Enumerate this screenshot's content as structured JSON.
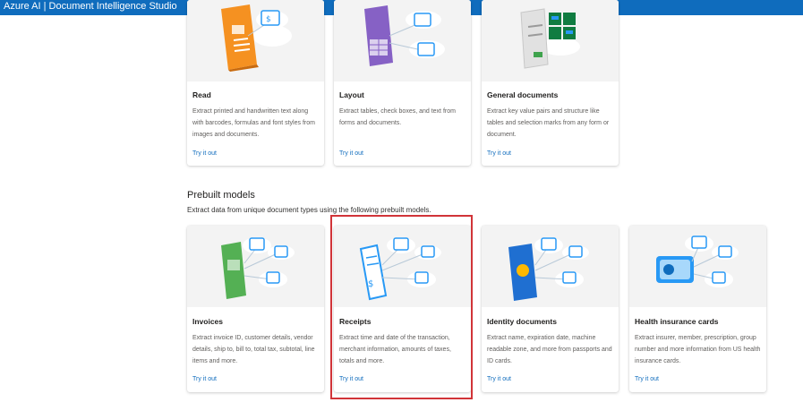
{
  "app": {
    "title": "Azure AI | Document Intelligence Studio"
  },
  "top_cards": [
    {
      "title": "Read",
      "description": "Extract printed and handwritten text along with barcodes, formulas and font styles from images and documents.",
      "link": "Try it out",
      "icon": "read-document-illustration"
    },
    {
      "title": "Layout",
      "description": "Extract tables, check boxes, and text from forms and documents.",
      "link": "Try it out",
      "icon": "layout-document-illustration"
    },
    {
      "title": "General documents",
      "description": "Extract key value pairs and structure like tables and selection marks from any form or document.",
      "link": "Try it out",
      "icon": "general-document-illustration"
    }
  ],
  "prebuilt": {
    "title": "Prebuilt models",
    "subtitle": "Extract data from unique document types using the following prebuilt models.",
    "cards": [
      {
        "title": "Invoices",
        "description": "Extract invoice ID, customer details, vendor details, ship to, bill to, total tax, subtotal, line items and more.",
        "link": "Try it out",
        "icon": "invoice-illustration"
      },
      {
        "title": "Receipts",
        "description": "Extract time and date of the transaction, merchant information, amounts of taxes, totals and more.",
        "link": "Try it out",
        "icon": "receipt-illustration"
      },
      {
        "title": "Identity documents",
        "description": "Extract name, expiration date, machine readable zone, and more from passports and ID cards.",
        "link": "Try it out",
        "icon": "passport-illustration"
      },
      {
        "title": "Health insurance cards",
        "description": "Extract insurer, member, prescription, group number and more information from US health insurance cards.",
        "link": "Try it out",
        "icon": "health-card-illustration"
      }
    ]
  },
  "colors": {
    "topbar": "#0f6cbd",
    "link": "#0f6cbd",
    "highlight": "#d13438"
  }
}
